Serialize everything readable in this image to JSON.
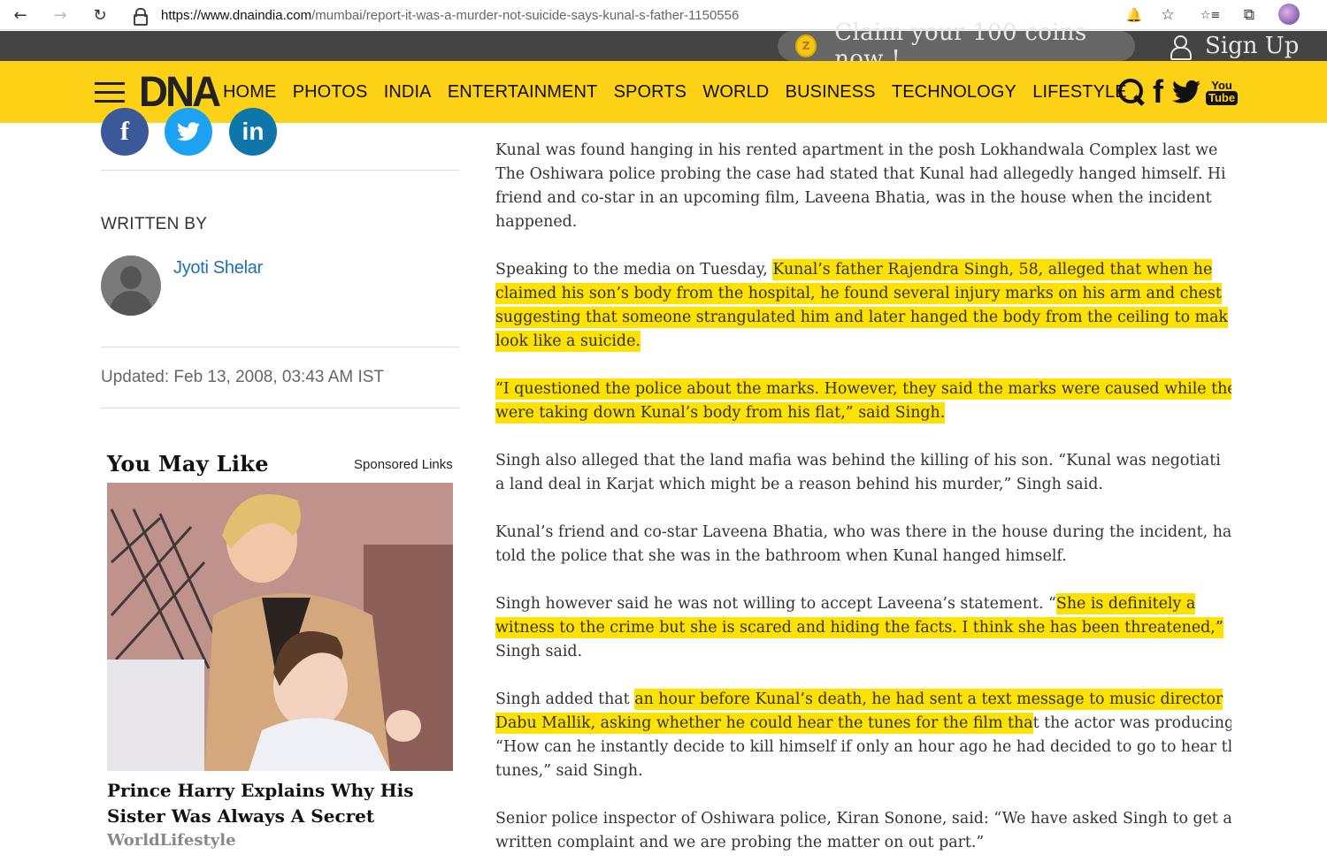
{
  "browser": {
    "url_host": "https://www.dnaindia.com",
    "url_path": "/mumbai/report-it-was-a-murder-not-suicide-says-kunal-s-father-1150556",
    "back_icon": "←",
    "forward_icon": "→",
    "reload_icon": "↻",
    "notifications_icon": "🔔",
    "favorite_icon": "☆",
    "favorites_icon": "☆≡",
    "collections_icon": "⧉"
  },
  "topbar": {
    "claim_text": "Claim your 100 coins now !",
    "signup_label": "Sign Up",
    "coin_symbol": "Z"
  },
  "nav": {
    "logo": "DNA",
    "items": [
      "HOME",
      "PHOTOS",
      "INDIA",
      "ENTERTAINMENT",
      "SPORTS",
      "WORLD",
      "BUSINESS",
      "TECHNOLOGY",
      "LIFESTYLE"
    ],
    "facebook_glyph": "f",
    "youtube_you": "You",
    "youtube_tube": "Tube",
    "accent_color": "#fcd116"
  },
  "sidebar": {
    "social": {
      "facebook": "f",
      "twitter": "🐦",
      "linkedin": "in"
    },
    "written_by_label": "WRITTEN BY",
    "author_name": "Jyoti Shelar",
    "updated": "Updated: Feb 13, 2008, 03:43 AM IST",
    "you_may_like": "You May Like",
    "sponsored": "Sponsored Links",
    "ad_title": "Prince Harry Explains Why His Sister Was Always A Secret",
    "ad_source": "WorldLifestyle"
  },
  "article": {
    "highlight_color": "#fde100",
    "p1": [
      "Kunal was found hanging in his rented apartment in the posh Lokhandwala Complex last we",
      "The Oshiwara police probing the case had stated that Kunal had allegedly hanged himself. Hi",
      "friend and co-star in an upcoming film, Laveena Bhatia, was in the house when the incident",
      "happened."
    ],
    "p2_lead": "Speaking to the media on Tuesday, ",
    "p2_hl": [
      "Kunal’s father Rajendra Singh, 58, alleged that when he",
      "claimed his son’s body from the hospital, he found several injury marks on his arm and chest",
      "suggesting that someone strangulated him and later hanged the body from the ceiling to mak",
      "look like a suicide."
    ],
    "p3_hl": [
      "“I questioned the police about the marks. However, they said the marks were caused while the",
      "were taking down Kunal’s body from his flat,” said Singh."
    ],
    "p4": [
      "Singh also alleged that the land mafia was behind the killing of his son. “Kunal was negotiati",
      "a land deal in Karjat which might be a reason behind his murder,” Singh said."
    ],
    "p5": [
      "Kunal’s friend and co-star Laveena Bhatia, who was there in the house during the incident, ha",
      "told the police that she was in the bathroom when Kunal hanged himself."
    ],
    "p6_lead": "Singh however said he was not willing to accept Laveena’s statement. “",
    "p6_hl1": "She is definitely a",
    "p6_hl2": "witness to the crime but she is scared and hiding the facts. I think she has been threatened,”",
    "p6_tail": "Singh said.",
    "p7_lead": "Singh added that ",
    "p7_hl1": "an hour before Kunal’s death, he had sent a text message to music director",
    "p7_hl2": "Dabu Mallik, asking whether he could hear the tunes for the film tha",
    "p7_tail2": "t the actor was producing",
    "p7_line3": "“How can he instantly decide to kill himself if only an hour ago he had decided to go to hear tl",
    "p7_line4": "tunes,” said Singh.",
    "p8": [
      "Senior police inspector of Oshiwara police, Kiran Sonone, said: “We have asked Singh to get a",
      "written complaint and we are probing the matter on out part.”"
    ]
  }
}
